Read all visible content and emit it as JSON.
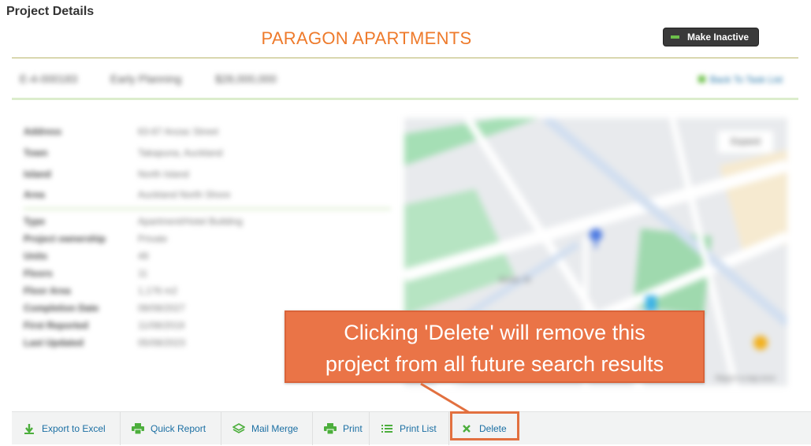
{
  "page": {
    "title": "Project Details"
  },
  "project": {
    "name": "PARAGON APARTMENTS"
  },
  "header": {
    "inactive_label": "Make Inactive"
  },
  "summary": {
    "id": "E-4-000183",
    "stage": "Early Planning",
    "value": "$28,000,000",
    "back_label": "Back To Task List"
  },
  "details": {
    "rows": [
      {
        "label": "Address",
        "value": "63-67 Anzac Street"
      },
      {
        "label": "Town",
        "value": "Takapuna, Auckland"
      },
      {
        "label": "Island",
        "value": "North Island"
      },
      {
        "label": "Area",
        "value": "Auckland North Shore"
      },
      {
        "label": "Type",
        "value": "Apartment/Hotel Building"
      },
      {
        "label": "Project ownership",
        "value": "Private"
      },
      {
        "label": "Units",
        "value": "49"
      },
      {
        "label": "Floors",
        "value": "11"
      },
      {
        "label": "Floor Area",
        "value": "1,176 m2"
      },
      {
        "label": "Completion Date",
        "value": "08/08/2027"
      },
      {
        "label": "First Reported",
        "value": "11/08/2019"
      },
      {
        "label": "Last Updated",
        "value": "05/08/2023"
      }
    ]
  },
  "map": {
    "expand_label": "Expand",
    "street_label": "Anzac St",
    "attribution": "Report a map error"
  },
  "callout": {
    "line1": "Clicking 'Delete' will remove this",
    "line2": "project from all future search results"
  },
  "toolbar": {
    "export": "Export to Excel",
    "quick_report": "Quick Report",
    "mail_merge": "Mail Merge",
    "print": "Print",
    "print_list": "Print List",
    "delete": "Delete"
  },
  "colors": {
    "accent": "#ee7a2b",
    "link": "#1b6fa3",
    "green": "#6cc04a",
    "callout": "#ea7447"
  }
}
